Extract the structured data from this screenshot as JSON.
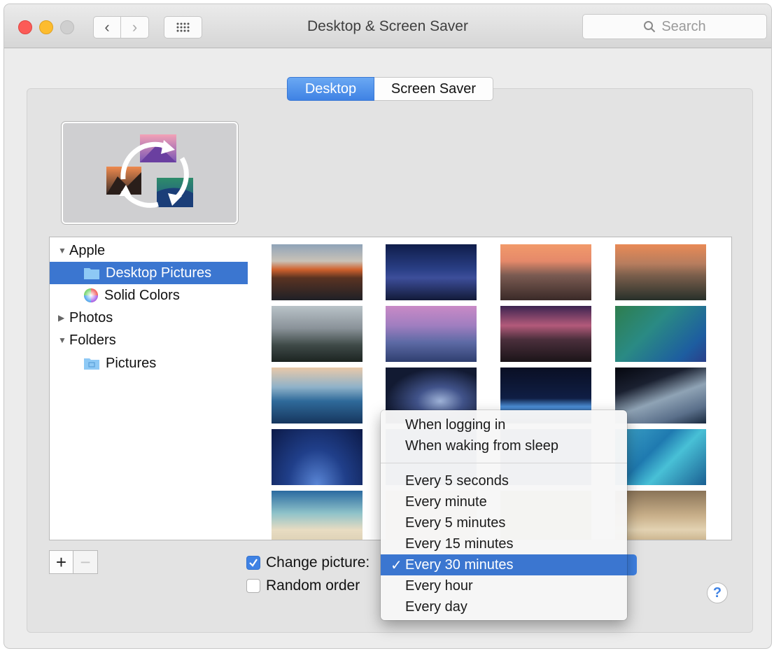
{
  "window": {
    "title": "Desktop & Screen Saver",
    "search_placeholder": "Search"
  },
  "tabs": [
    {
      "label": "Desktop",
      "selected": true
    },
    {
      "label": "Screen Saver",
      "selected": false
    }
  ],
  "sources": [
    {
      "label": "Apple",
      "kind": "group",
      "expanded": true
    },
    {
      "label": "Desktop Pictures",
      "kind": "folder",
      "selected": true
    },
    {
      "label": "Solid Colors",
      "kind": "color-wheel"
    },
    {
      "label": "Photos",
      "kind": "group",
      "expanded": false
    },
    {
      "label": "Folders",
      "kind": "group",
      "expanded": true
    },
    {
      "label": "Pictures",
      "kind": "folder"
    }
  ],
  "wallpapers": [
    "el-capitan-dusk",
    "yosemite-night",
    "half-dome-sunset",
    "el-capitan-cliff",
    "yosemite-snow",
    "half-dome-purple",
    "lake-rocks-sunset",
    "green-wave",
    "ocean-wave",
    "galaxy",
    "earth-horizon",
    "earth-from-space",
    "milky-way",
    "hidden-1",
    "hidden-2",
    "blue-water",
    "beach-shore",
    "hidden-3",
    "hidden-4",
    "sand-dunes"
  ],
  "options": {
    "change_picture_label": "Change picture:",
    "change_picture_checked": true,
    "random_order_label": "Random order",
    "random_order_checked": false
  },
  "interval_menu": {
    "items": [
      "When logging in",
      "When waking from sleep",
      "Every 5 seconds",
      "Every minute",
      "Every 5 minutes",
      "Every 15 minutes",
      "Every 30 minutes",
      "Every hour",
      "Every day"
    ],
    "selected": "Every 30 minutes"
  },
  "help_label": "?",
  "colors": {
    "accent": "#3b76d0",
    "close": "#fc5b57",
    "minimize": "#fdbc2e"
  }
}
